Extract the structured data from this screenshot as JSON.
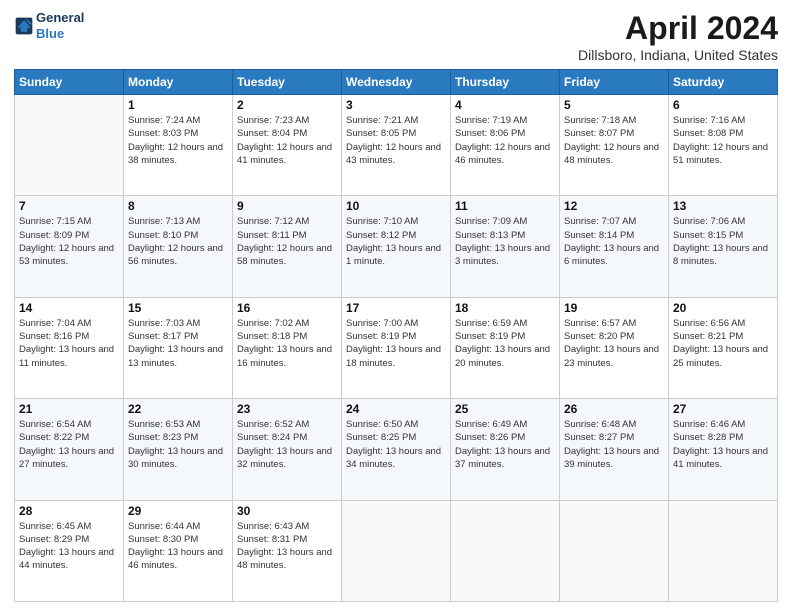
{
  "logo": {
    "line1": "General",
    "line2": "Blue"
  },
  "title": "April 2024",
  "subtitle": "Dillsboro, Indiana, United States",
  "header_days": [
    "Sunday",
    "Monday",
    "Tuesday",
    "Wednesday",
    "Thursday",
    "Friday",
    "Saturday"
  ],
  "weeks": [
    [
      {
        "day": "",
        "sunrise": "",
        "sunset": "",
        "daylight": ""
      },
      {
        "day": "1",
        "sunrise": "Sunrise: 7:24 AM",
        "sunset": "Sunset: 8:03 PM",
        "daylight": "Daylight: 12 hours and 38 minutes."
      },
      {
        "day": "2",
        "sunrise": "Sunrise: 7:23 AM",
        "sunset": "Sunset: 8:04 PM",
        "daylight": "Daylight: 12 hours and 41 minutes."
      },
      {
        "day": "3",
        "sunrise": "Sunrise: 7:21 AM",
        "sunset": "Sunset: 8:05 PM",
        "daylight": "Daylight: 12 hours and 43 minutes."
      },
      {
        "day": "4",
        "sunrise": "Sunrise: 7:19 AM",
        "sunset": "Sunset: 8:06 PM",
        "daylight": "Daylight: 12 hours and 46 minutes."
      },
      {
        "day": "5",
        "sunrise": "Sunrise: 7:18 AM",
        "sunset": "Sunset: 8:07 PM",
        "daylight": "Daylight: 12 hours and 48 minutes."
      },
      {
        "day": "6",
        "sunrise": "Sunrise: 7:16 AM",
        "sunset": "Sunset: 8:08 PM",
        "daylight": "Daylight: 12 hours and 51 minutes."
      }
    ],
    [
      {
        "day": "7",
        "sunrise": "Sunrise: 7:15 AM",
        "sunset": "Sunset: 8:09 PM",
        "daylight": "Daylight: 12 hours and 53 minutes."
      },
      {
        "day": "8",
        "sunrise": "Sunrise: 7:13 AM",
        "sunset": "Sunset: 8:10 PM",
        "daylight": "Daylight: 12 hours and 56 minutes."
      },
      {
        "day": "9",
        "sunrise": "Sunrise: 7:12 AM",
        "sunset": "Sunset: 8:11 PM",
        "daylight": "Daylight: 12 hours and 58 minutes."
      },
      {
        "day": "10",
        "sunrise": "Sunrise: 7:10 AM",
        "sunset": "Sunset: 8:12 PM",
        "daylight": "Daylight: 13 hours and 1 minute."
      },
      {
        "day": "11",
        "sunrise": "Sunrise: 7:09 AM",
        "sunset": "Sunset: 8:13 PM",
        "daylight": "Daylight: 13 hours and 3 minutes."
      },
      {
        "day": "12",
        "sunrise": "Sunrise: 7:07 AM",
        "sunset": "Sunset: 8:14 PM",
        "daylight": "Daylight: 13 hours and 6 minutes."
      },
      {
        "day": "13",
        "sunrise": "Sunrise: 7:06 AM",
        "sunset": "Sunset: 8:15 PM",
        "daylight": "Daylight: 13 hours and 8 minutes."
      }
    ],
    [
      {
        "day": "14",
        "sunrise": "Sunrise: 7:04 AM",
        "sunset": "Sunset: 8:16 PM",
        "daylight": "Daylight: 13 hours and 11 minutes."
      },
      {
        "day": "15",
        "sunrise": "Sunrise: 7:03 AM",
        "sunset": "Sunset: 8:17 PM",
        "daylight": "Daylight: 13 hours and 13 minutes."
      },
      {
        "day": "16",
        "sunrise": "Sunrise: 7:02 AM",
        "sunset": "Sunset: 8:18 PM",
        "daylight": "Daylight: 13 hours and 16 minutes."
      },
      {
        "day": "17",
        "sunrise": "Sunrise: 7:00 AM",
        "sunset": "Sunset: 8:19 PM",
        "daylight": "Daylight: 13 hours and 18 minutes."
      },
      {
        "day": "18",
        "sunrise": "Sunrise: 6:59 AM",
        "sunset": "Sunset: 8:19 PM",
        "daylight": "Daylight: 13 hours and 20 minutes."
      },
      {
        "day": "19",
        "sunrise": "Sunrise: 6:57 AM",
        "sunset": "Sunset: 8:20 PM",
        "daylight": "Daylight: 13 hours and 23 minutes."
      },
      {
        "day": "20",
        "sunrise": "Sunrise: 6:56 AM",
        "sunset": "Sunset: 8:21 PM",
        "daylight": "Daylight: 13 hours and 25 minutes."
      }
    ],
    [
      {
        "day": "21",
        "sunrise": "Sunrise: 6:54 AM",
        "sunset": "Sunset: 8:22 PM",
        "daylight": "Daylight: 13 hours and 27 minutes."
      },
      {
        "day": "22",
        "sunrise": "Sunrise: 6:53 AM",
        "sunset": "Sunset: 8:23 PM",
        "daylight": "Daylight: 13 hours and 30 minutes."
      },
      {
        "day": "23",
        "sunrise": "Sunrise: 6:52 AM",
        "sunset": "Sunset: 8:24 PM",
        "daylight": "Daylight: 13 hours and 32 minutes."
      },
      {
        "day": "24",
        "sunrise": "Sunrise: 6:50 AM",
        "sunset": "Sunset: 8:25 PM",
        "daylight": "Daylight: 13 hours and 34 minutes."
      },
      {
        "day": "25",
        "sunrise": "Sunrise: 6:49 AM",
        "sunset": "Sunset: 8:26 PM",
        "daylight": "Daylight: 13 hours and 37 minutes."
      },
      {
        "day": "26",
        "sunrise": "Sunrise: 6:48 AM",
        "sunset": "Sunset: 8:27 PM",
        "daylight": "Daylight: 13 hours and 39 minutes."
      },
      {
        "day": "27",
        "sunrise": "Sunrise: 6:46 AM",
        "sunset": "Sunset: 8:28 PM",
        "daylight": "Daylight: 13 hours and 41 minutes."
      }
    ],
    [
      {
        "day": "28",
        "sunrise": "Sunrise: 6:45 AM",
        "sunset": "Sunset: 8:29 PM",
        "daylight": "Daylight: 13 hours and 44 minutes."
      },
      {
        "day": "29",
        "sunrise": "Sunrise: 6:44 AM",
        "sunset": "Sunset: 8:30 PM",
        "daylight": "Daylight: 13 hours and 46 minutes."
      },
      {
        "day": "30",
        "sunrise": "Sunrise: 6:43 AM",
        "sunset": "Sunset: 8:31 PM",
        "daylight": "Daylight: 13 hours and 48 minutes."
      },
      {
        "day": "",
        "sunrise": "",
        "sunset": "",
        "daylight": ""
      },
      {
        "day": "",
        "sunrise": "",
        "sunset": "",
        "daylight": ""
      },
      {
        "day": "",
        "sunrise": "",
        "sunset": "",
        "daylight": ""
      },
      {
        "day": "",
        "sunrise": "",
        "sunset": "",
        "daylight": ""
      }
    ]
  ]
}
